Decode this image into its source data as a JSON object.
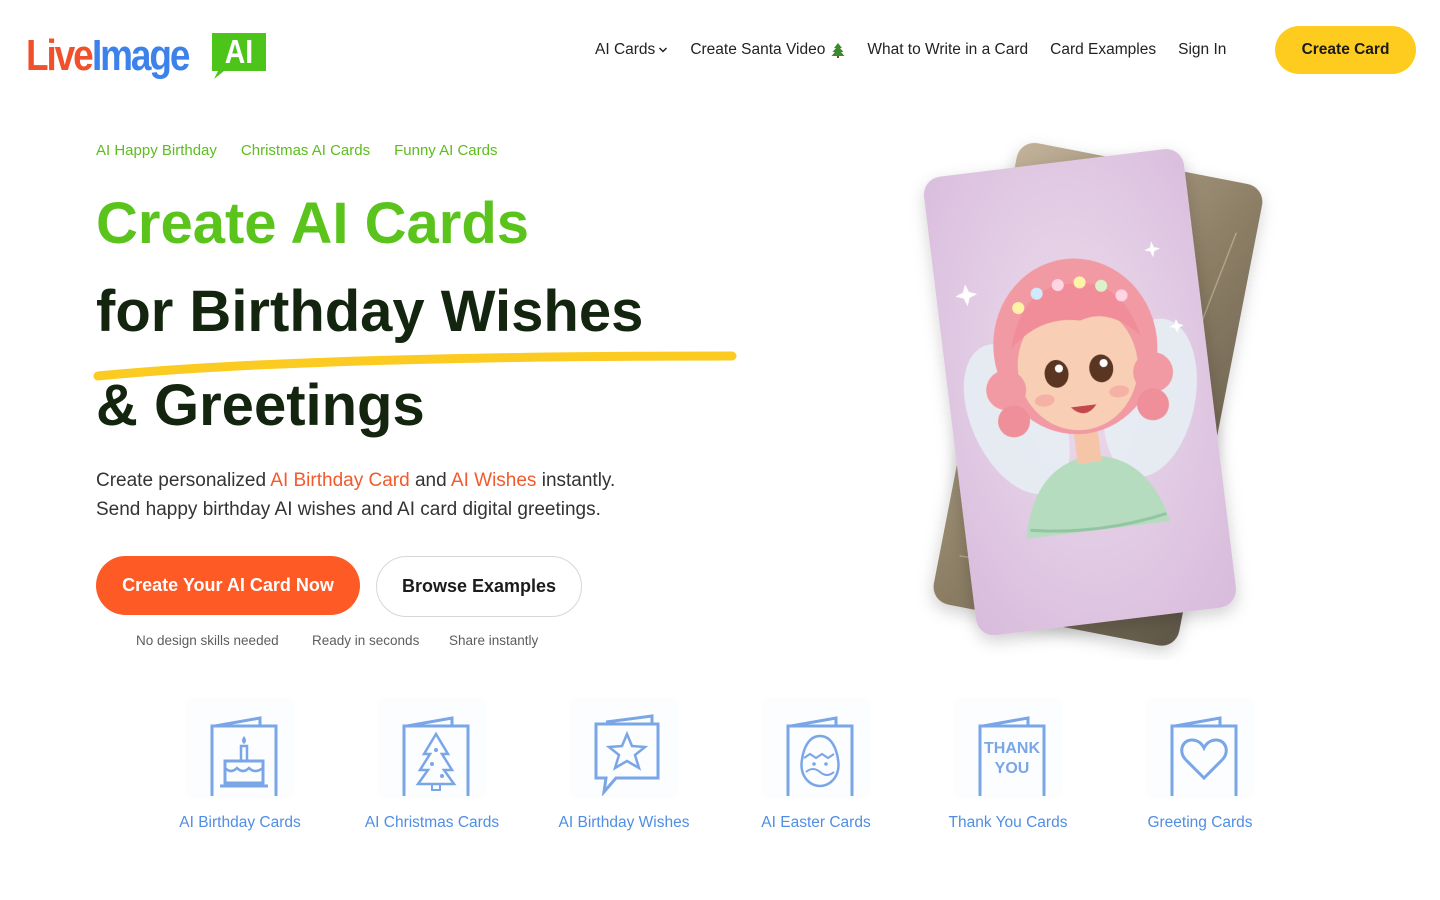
{
  "brand": {
    "logo_live": "Live",
    "logo_image": "Image",
    "logo_ai": "AI",
    "colors": {
      "red": "#f0502a",
      "blue": "#3d82ea",
      "green": "#4cc41a"
    }
  },
  "nav": {
    "items": [
      {
        "label": "AI Cards",
        "icon": "chevron-down-icon"
      },
      {
        "label": "Create Santa Video",
        "icon": "christmas-tree-icon"
      },
      {
        "label": "What to Write in a Card"
      },
      {
        "label": "Card Examples"
      },
      {
        "label": "Sign In"
      }
    ],
    "cta": "Create Card"
  },
  "hero": {
    "quick_links": [
      "AI Happy Birthday",
      "Christmas AI Cards",
      "Funny AI Cards"
    ],
    "headline_1": "Create AI Cards",
    "headline_2": "for Birthday Wishes",
    "headline_3": "& Greetings",
    "desc_1_pre": "Create personalized ",
    "desc_1_link1": "AI Birthday Card",
    "desc_1_mid": " and ",
    "desc_1_link2": "AI Wishes",
    "desc_1_post": " instantly.",
    "desc_2": "Send happy birthday AI wishes and AI card digital greetings.",
    "primary_cta": "Create Your AI Card Now",
    "secondary_cta": "Browse Examples",
    "features": [
      "No design skills needed",
      "Ready in seconds",
      "Share instantly"
    ],
    "colors": {
      "green": "#5ac41c",
      "dark": "#13240f",
      "orange": "#fe5a26",
      "yellow": "#fecc1f"
    }
  },
  "categories": [
    {
      "label": "AI Birthday Cards",
      "icon": "birthday-cake-card-icon"
    },
    {
      "label": "AI Christmas Cards",
      "icon": "christmas-tree-card-icon"
    },
    {
      "label": "AI Birthday Wishes",
      "icon": "star-message-card-icon"
    },
    {
      "label": "AI Easter Cards",
      "icon": "easter-egg-card-icon"
    },
    {
      "label": "Thank You Cards",
      "icon": "thank-you-card-icon",
      "icon_text_1": "THANK",
      "icon_text_2": "YOU"
    },
    {
      "label": "Greeting Cards",
      "icon": "heart-card-icon"
    }
  ]
}
